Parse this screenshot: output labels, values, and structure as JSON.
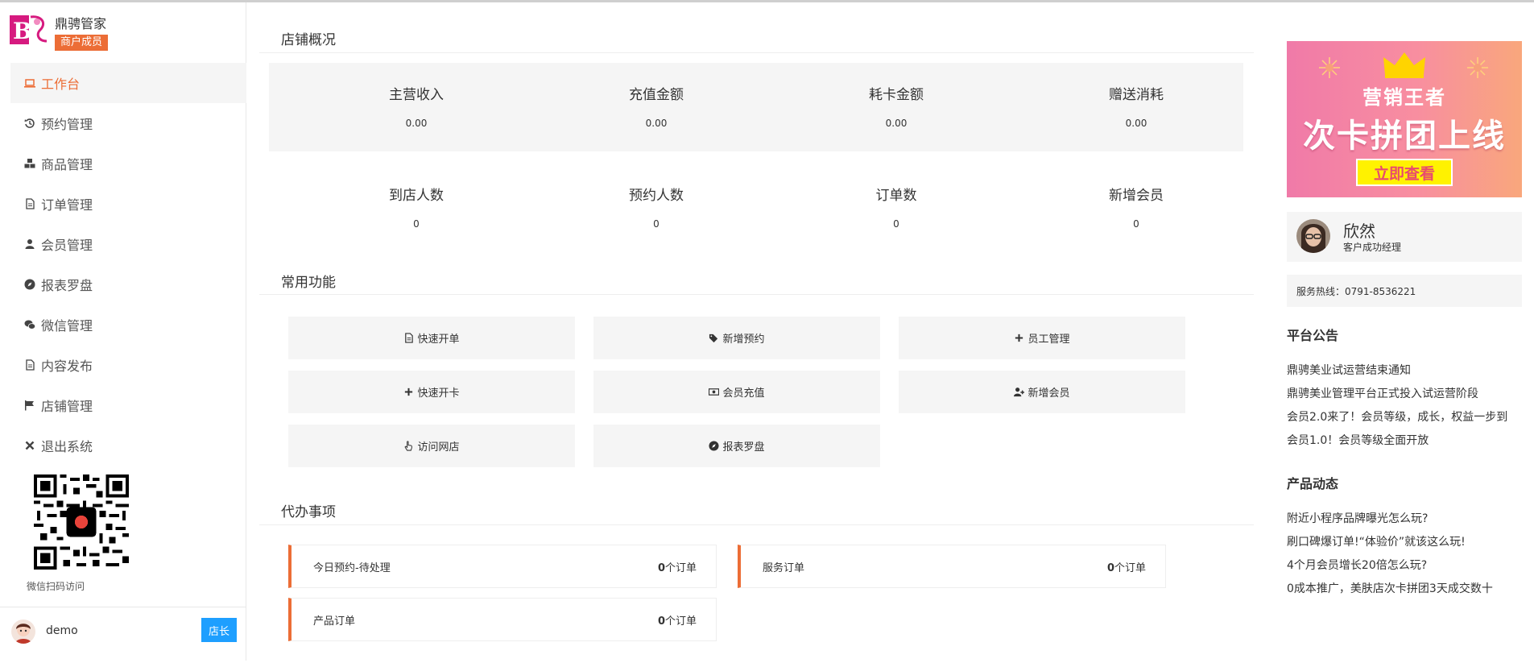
{
  "brand": {
    "name": "鼎骋管家",
    "badge": "商户成员"
  },
  "nav": [
    {
      "label": "工作台",
      "icon": "laptop-icon",
      "active": true
    },
    {
      "label": "预约管理",
      "icon": "history-icon"
    },
    {
      "label": "商品管理",
      "icon": "cubes-icon"
    },
    {
      "label": "订单管理",
      "icon": "file-icon"
    },
    {
      "label": "会员管理",
      "icon": "user-icon"
    },
    {
      "label": "报表罗盘",
      "icon": "compass-icon"
    },
    {
      "label": "微信管理",
      "icon": "wechat-icon"
    },
    {
      "label": "内容发布",
      "icon": "file-icon"
    },
    {
      "label": "店铺管理",
      "icon": "flag-icon"
    },
    {
      "label": "退出系统",
      "icon": "close-icon"
    }
  ],
  "qr": {
    "caption": "微信扫码访问"
  },
  "user": {
    "name": "demo",
    "role": "店长"
  },
  "overview": {
    "title": "店铺概况",
    "row1": [
      {
        "label": "主营收入",
        "value": "0.00"
      },
      {
        "label": "充值金额",
        "value": "0.00"
      },
      {
        "label": "耗卡金额",
        "value": "0.00"
      },
      {
        "label": "赠送消耗",
        "value": "0.00"
      }
    ],
    "row2": [
      {
        "label": "到店人数",
        "value": "0"
      },
      {
        "label": "预约人数",
        "value": "0"
      },
      {
        "label": "订单数",
        "value": "0"
      },
      {
        "label": "新增会员",
        "value": "0"
      }
    ]
  },
  "functions": {
    "title": "常用功能",
    "items": [
      {
        "label": "快速开单",
        "icon": "file-icon"
      },
      {
        "label": "新增预约",
        "icon": "tags-icon"
      },
      {
        "label": "员工管理",
        "icon": "plus-icon"
      },
      {
        "label": "快速开卡",
        "icon": "plus-icon"
      },
      {
        "label": "会员充值",
        "icon": "money-icon"
      },
      {
        "label": "新增会员",
        "icon": "user-plus-icon"
      },
      {
        "label": "访问网店",
        "icon": "hand-pointer-icon"
      },
      {
        "label": "报表罗盘",
        "icon": "compass-icon"
      }
    ]
  },
  "todo": {
    "title": "代办事项",
    "items": [
      {
        "label": "今日预约-待处理",
        "count": "0",
        "unit": "个订单"
      },
      {
        "label": "服务订单",
        "count": "0",
        "unit": "个订单"
      },
      {
        "label": "产品订单",
        "count": "0",
        "unit": "个订单"
      }
    ]
  },
  "banner": {
    "small": "营销王者",
    "big": "次卡拼团上线",
    "button": "立即查看"
  },
  "manager": {
    "name": "欣然",
    "role": "客户成功经理"
  },
  "hotline": "服务热线：0791-8536221",
  "announcements": {
    "title": "平台公告",
    "items": [
      "鼎骋美业试运营结束通知",
      "鼎骋美业管理平台正式投入试运营阶段",
      "会员2.0来了！会员等级，成长，权益一步到",
      "会员1.0！会员等级全面开放"
    ]
  },
  "news": {
    "title": "产品动态",
    "items": [
      "附近小程序品牌曝光怎么玩?",
      "刷口碑爆订单!“体验价”就该这么玩!",
      "4个月会员增长20倍怎么玩?",
      "0成本推广，美肤店次卡拼团3天成交数十"
    ]
  },
  "colors": {
    "accent": "#ec6d36",
    "primary_button": "#1e9fff",
    "panel": "#f5f5f5"
  }
}
